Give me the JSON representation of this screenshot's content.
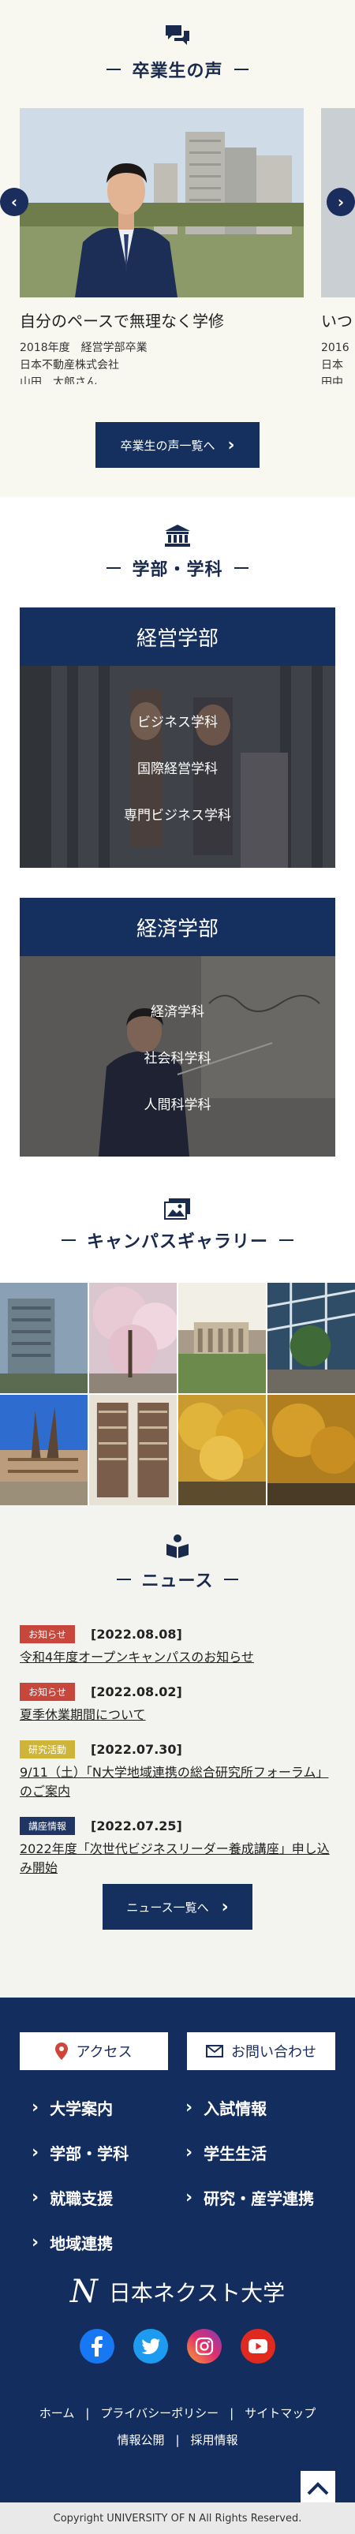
{
  "graduates": {
    "title": "卒業生の声",
    "slides": [
      {
        "caption": "自分のペースで無理なく学修",
        "year": "2018年度　経営学部卒業",
        "company": "日本不動産株式会社",
        "name": "山田　太郎さん"
      },
      {
        "caption": "いつ",
        "year": "2016",
        "company": "日本",
        "name": "田中"
      }
    ],
    "list_button": "卒業生の声一覧へ"
  },
  "faculties": {
    "title": "学部・学科",
    "items": [
      {
        "name": "経営学部",
        "departments": [
          "ビジネス学科",
          "国際経営学科",
          "専門ビジネス学科"
        ]
      },
      {
        "name": "経済学部",
        "departments": [
          "経済学科",
          "社会科学科",
          "人間科学科"
        ]
      }
    ]
  },
  "gallery": {
    "title": "キャンパスギャラリー"
  },
  "news": {
    "title": "ニュース",
    "items": [
      {
        "category": "お知らせ",
        "color": "#c8473c",
        "date": "[2022.08.08]",
        "title": "令和4年度オープンキャンパスのお知らせ"
      },
      {
        "category": "お知らせ",
        "color": "#c8473c",
        "date": "[2022.08.02]",
        "title": "夏季休業期間について"
      },
      {
        "category": "研究活動",
        "color": "#cfb43a",
        "date": "[2022.07.30]",
        "title": "9/11（土）「N大学地域連携の総合研究所フォーラム」のご案内"
      },
      {
        "category": "講座情報",
        "color": "#1f3563",
        "date": "[2022.07.25]",
        "title": "2022年度「次世代ビジネスリーダー養成講座」申し込み開始"
      }
    ],
    "list_button": "ニュース一覧へ"
  },
  "footer": {
    "access": "アクセス",
    "contact": "お問い合わせ",
    "nav": [
      "大学案内",
      "入試情報",
      "学部・学科",
      "学生生活",
      "就職支援",
      "研究・産学連携",
      "地域連携"
    ],
    "logo_mark": "N",
    "university": "日本ネクスト大学",
    "links_row1": [
      "ホーム",
      "プライバシーポリシー",
      "サイトマップ"
    ],
    "links_row2": [
      "情報公開",
      "採用情報"
    ],
    "copyright": "Copyright UNIVERSITY OF N All Rights Reserved."
  },
  "colors": {
    "navy": "#132d5e",
    "badge_notice": "#c8473c",
    "badge_research": "#cfb43a",
    "badge_lecture": "#1f3563"
  }
}
